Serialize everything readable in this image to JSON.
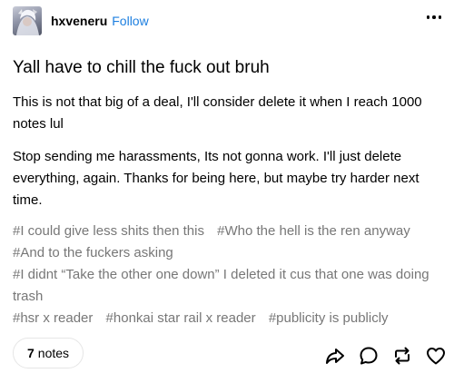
{
  "post": {
    "blog_name": "hxveneru",
    "follow_label": "Follow",
    "title": "Yall have to chill the fuck out bruh",
    "paragraphs": [
      "This is not that big of a deal, I'll consider delete it when I reach 1000 notes lul",
      "Stop sending me harassments, Its not gonna work. I'll just delete everything, again. Thanks for being here, but maybe try harder next time."
    ],
    "tags": [
      "#I could give less shits then this",
      "#Who the hell is the ren anyway",
      "#And to the fuckers asking",
      "#I didnt “Take the other one down” I deleted it cus that one was doing trash",
      "#hsr x reader",
      "#honkai star rail x reader",
      "#publicity is publicly"
    ],
    "notes_count": "7",
    "notes_label": "notes"
  },
  "icons": {
    "more": "more-options-icon",
    "share": "share-icon",
    "reply": "reply-icon",
    "reblog": "reblog-icon",
    "like": "heart-icon"
  },
  "colors": {
    "follow_link": "#1d7fe0",
    "tag_text": "#777777",
    "text": "#000000"
  }
}
